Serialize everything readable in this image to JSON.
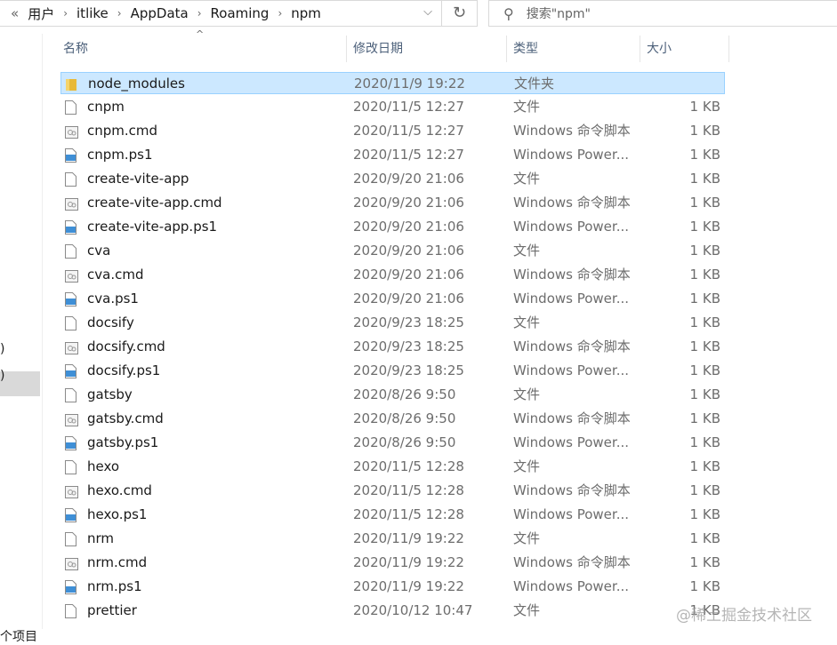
{
  "address": {
    "prefix": "«",
    "crumbs": [
      "用户",
      "itlike",
      "AppData",
      "Roaming",
      "npm"
    ]
  },
  "search": {
    "placeholder": "搜索\"npm\""
  },
  "nav": {
    "fragments": [
      ")",
      ")"
    ]
  },
  "columns": {
    "name": "名称",
    "date": "修改日期",
    "type": "类型",
    "size": "大小"
  },
  "files": [
    {
      "name": "node_modules",
      "date": "2020/11/9 19:22",
      "type": "文件夹",
      "size": "",
      "kind": "folder",
      "selected": true
    },
    {
      "name": "cnpm",
      "date": "2020/11/5 12:27",
      "type": "文件",
      "size": "1 KB",
      "kind": "file"
    },
    {
      "name": "cnpm.cmd",
      "date": "2020/11/5 12:27",
      "type": "Windows 命令脚本",
      "size": "1 KB",
      "kind": "cmd"
    },
    {
      "name": "cnpm.ps1",
      "date": "2020/11/5 12:27",
      "type": "Windows Power...",
      "size": "1 KB",
      "kind": "ps1"
    },
    {
      "name": "create-vite-app",
      "date": "2020/9/20 21:06",
      "type": "文件",
      "size": "1 KB",
      "kind": "file"
    },
    {
      "name": "create-vite-app.cmd",
      "date": "2020/9/20 21:06",
      "type": "Windows 命令脚本",
      "size": "1 KB",
      "kind": "cmd"
    },
    {
      "name": "create-vite-app.ps1",
      "date": "2020/9/20 21:06",
      "type": "Windows Power...",
      "size": "1 KB",
      "kind": "ps1"
    },
    {
      "name": "cva",
      "date": "2020/9/20 21:06",
      "type": "文件",
      "size": "1 KB",
      "kind": "file"
    },
    {
      "name": "cva.cmd",
      "date": "2020/9/20 21:06",
      "type": "Windows 命令脚本",
      "size": "1 KB",
      "kind": "cmd"
    },
    {
      "name": "cva.ps1",
      "date": "2020/9/20 21:06",
      "type": "Windows Power...",
      "size": "1 KB",
      "kind": "ps1"
    },
    {
      "name": "docsify",
      "date": "2020/9/23 18:25",
      "type": "文件",
      "size": "1 KB",
      "kind": "file"
    },
    {
      "name": "docsify.cmd",
      "date": "2020/9/23 18:25",
      "type": "Windows 命令脚本",
      "size": "1 KB",
      "kind": "cmd"
    },
    {
      "name": "docsify.ps1",
      "date": "2020/9/23 18:25",
      "type": "Windows Power...",
      "size": "1 KB",
      "kind": "ps1"
    },
    {
      "name": "gatsby",
      "date": "2020/8/26 9:50",
      "type": "文件",
      "size": "1 KB",
      "kind": "file"
    },
    {
      "name": "gatsby.cmd",
      "date": "2020/8/26 9:50",
      "type": "Windows 命令脚本",
      "size": "1 KB",
      "kind": "cmd"
    },
    {
      "name": "gatsby.ps1",
      "date": "2020/8/26 9:50",
      "type": "Windows Power...",
      "size": "1 KB",
      "kind": "ps1"
    },
    {
      "name": "hexo",
      "date": "2020/11/5 12:28",
      "type": "文件",
      "size": "1 KB",
      "kind": "file"
    },
    {
      "name": "hexo.cmd",
      "date": "2020/11/5 12:28",
      "type": "Windows 命令脚本",
      "size": "1 KB",
      "kind": "cmd"
    },
    {
      "name": "hexo.ps1",
      "date": "2020/11/5 12:28",
      "type": "Windows Power...",
      "size": "1 KB",
      "kind": "ps1"
    },
    {
      "name": "nrm",
      "date": "2020/11/9 19:22",
      "type": "文件",
      "size": "1 KB",
      "kind": "file"
    },
    {
      "name": "nrm.cmd",
      "date": "2020/11/9 19:22",
      "type": "Windows 命令脚本",
      "size": "1 KB",
      "kind": "cmd"
    },
    {
      "name": "nrm.ps1",
      "date": "2020/11/9 19:22",
      "type": "Windows Power...",
      "size": "1 KB",
      "kind": "ps1"
    },
    {
      "name": "prettier",
      "date": "2020/10/12 10:47",
      "type": "文件",
      "size": "1 KB",
      "kind": "file"
    }
  ],
  "status": {
    "text": "个项目"
  },
  "watermark": "@稀土掘金技术社区"
}
